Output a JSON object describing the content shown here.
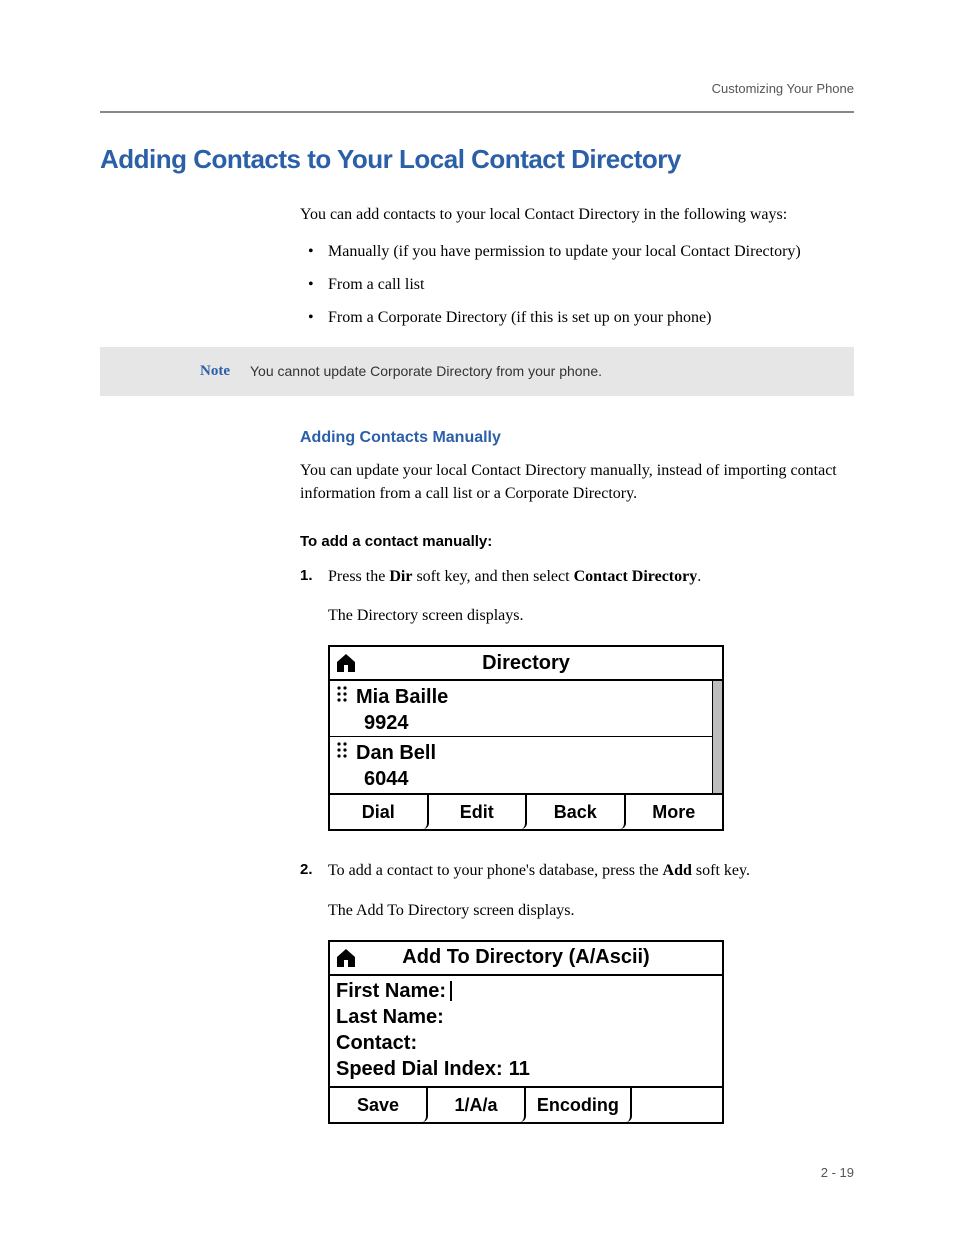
{
  "header": {
    "breadcrumb": "Customizing Your Phone"
  },
  "section": {
    "title": "Adding Contacts to Your Local Contact Directory",
    "intro": "You can add contacts to your local Contact Directory in the following ways:",
    "bullets": [
      "Manually (if you have permission to update your local Contact Directory)",
      "From a call list",
      "From a Corporate Directory (if this is set up on your phone)"
    ]
  },
  "note": {
    "label": "Note",
    "text": "You cannot update Corporate Directory from your phone."
  },
  "sub": {
    "title": "Adding Contacts Manually",
    "body": "You can update your local Contact Directory manually, instead of importing contact information from a call list or a Corporate Directory."
  },
  "proc": {
    "title": "To add a contact manually:",
    "steps": [
      {
        "num": "1.",
        "pre": "Press the ",
        "b1": "Dir",
        "mid": " soft key, and then select ",
        "b2": "Contact Directory",
        "post": ".",
        "sub": "The Directory screen displays."
      },
      {
        "num": "2.",
        "pre": "To add a contact to your phone's database, press the ",
        "b1": "Add",
        "mid": " soft key.",
        "b2": "",
        "post": "",
        "sub": "The Add To Directory screen displays."
      }
    ]
  },
  "screen1": {
    "title": "Directory",
    "entry1_name": "Mia Baille",
    "entry1_num": "9924",
    "entry2_name": "Dan Bell",
    "entry2_num": "6044",
    "keys": [
      "Dial",
      "Edit",
      "Back",
      "More"
    ]
  },
  "screen2": {
    "title": "Add To Directory (A/Ascii)",
    "f1": "First Name:",
    "f2": "Last Name:",
    "f3": "Contact:",
    "f4_label": "Speed Dial Index:",
    "f4_value": "11",
    "keys": [
      "Save",
      "1/A/a",
      "Encoding"
    ]
  },
  "footer": {
    "page": "2 - 19"
  }
}
